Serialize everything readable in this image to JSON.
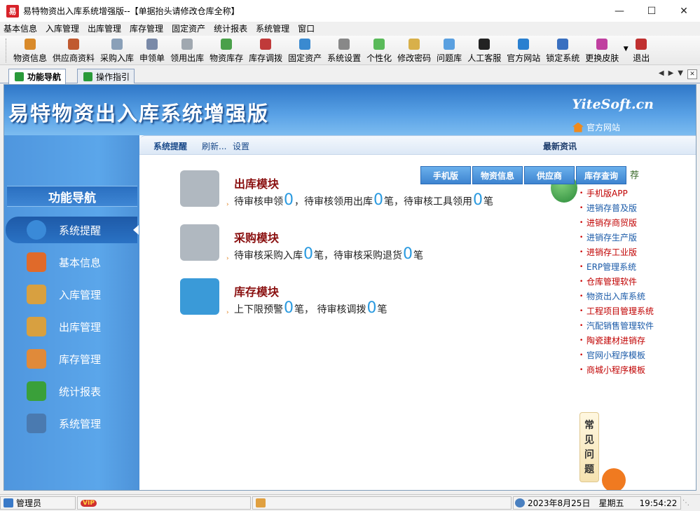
{
  "window": {
    "title": "易特物资出入库系统增强版--【单据抬头请修改仓库全称】",
    "app_icon_text": "易"
  },
  "menu": [
    "基本信息",
    "入库管理",
    "出库管理",
    "库存管理",
    "固定资产",
    "统计报表",
    "系统管理",
    "窗口"
  ],
  "toolbar": [
    {
      "label": "物资信息",
      "icon": "box-icon",
      "color": "#d98a2a"
    },
    {
      "label": "供应商资料",
      "icon": "people-icon",
      "color": "#c05a30"
    },
    {
      "label": "采购入库",
      "icon": "cart-in-icon",
      "color": "#8aa0b8"
    },
    {
      "label": "申领单",
      "icon": "calculator-icon",
      "color": "#7a8aa8"
    },
    {
      "label": "领用出库",
      "icon": "cart-out-icon",
      "color": "#a0a8b0"
    },
    {
      "label": "物资库存",
      "icon": "cubes-icon",
      "color": "#4aa04a"
    },
    {
      "label": "库存调拨",
      "icon": "transfer-icon",
      "color": "#c03a3a"
    },
    {
      "label": "固定资产",
      "icon": "stack-icon",
      "color": "#3a8ad0"
    },
    {
      "label": "系统设置",
      "icon": "settings-icon",
      "color": "#888888"
    },
    {
      "label": "个性化",
      "icon": "palette-icon",
      "color": "#5aba5a"
    },
    {
      "label": "修改密码",
      "icon": "pencil-icon",
      "color": "#d8b04a"
    },
    {
      "label": "问题库",
      "icon": "question-icon",
      "color": "#5aa0e0"
    },
    {
      "label": "人工客服",
      "icon": "qq-icon",
      "color": "#222222"
    },
    {
      "label": "官方网站",
      "icon": "ie-icon",
      "color": "#2a80d0"
    },
    {
      "label": "锁定系统",
      "icon": "lock-icon",
      "color": "#3a70c0"
    },
    {
      "label": "更换皮肤",
      "icon": "skin-icon",
      "color": "#c040a0"
    },
    {
      "label": "退出",
      "icon": "exit-icon",
      "color": "#c03030"
    }
  ],
  "tabs": [
    {
      "label": "功能导航",
      "active": true
    },
    {
      "label": "操作指引",
      "active": false
    }
  ],
  "banner": {
    "title": "易特物资出入库系统增强版",
    "site": "YiteSoft.cn",
    "home_link": "官方网站"
  },
  "sidebar": {
    "heading": "功能导航",
    "items": [
      {
        "label": "系统提醒",
        "icon": "info-icon",
        "color": "#3a8ad8",
        "active": true
      },
      {
        "label": "基本信息",
        "icon": "cubes-icon",
        "color": "#e06a2a",
        "active": false
      },
      {
        "label": "入库管理",
        "icon": "box-in-icon",
        "color": "#d8a040",
        "active": false
      },
      {
        "label": "出库管理",
        "icon": "box-out-icon",
        "color": "#d8a040",
        "active": false
      },
      {
        "label": "库存管理",
        "icon": "house-icon",
        "color": "#e08a3a",
        "active": false
      },
      {
        "label": "统计报表",
        "icon": "bar-chart-icon",
        "color": "#3aa03a",
        "active": false
      },
      {
        "label": "系统管理",
        "icon": "tools-icon",
        "color": "#4a7ab0",
        "active": false
      }
    ]
  },
  "content_head": {
    "reminder": "系统提醒",
    "refresh": "刷新...",
    "settings": "设置",
    "news_title": "最新资讯"
  },
  "modules": [
    {
      "title": "出库模块",
      "icon": "cart-remove-icon",
      "color": "#b0b8c0",
      "parts": [
        "待审核申领",
        "0",
        "，待审核领用出库",
        "0",
        "笔，待审核工具领用",
        "0",
        "笔"
      ]
    },
    {
      "title": "采购模块",
      "icon": "cart-add-icon",
      "color": "#b0b8c0",
      "parts": [
        "待审核采购入库",
        "0",
        "笔，待审核采购退货",
        "0",
        "笔"
      ]
    },
    {
      "title": "库存模块",
      "icon": "cubes-icon",
      "color": "#3a9ad8",
      "parts": [
        "上下限预警",
        "0",
        "笔，  待审核调拨",
        "0",
        "笔"
      ]
    }
  ],
  "news": {
    "tabs": [
      "手机版",
      "物资信息",
      "供应商",
      "库存查询"
    ],
    "tail_text": "荐",
    "items": [
      {
        "label": "手机版APP",
        "color": "#c00000"
      },
      {
        "label": "进销存普及版",
        "color": "#1a5aa8"
      },
      {
        "label": "进销存商贸版",
        "color": "#c00000"
      },
      {
        "label": "进销存生产版",
        "color": "#1a5aa8"
      },
      {
        "label": "进销存工业版",
        "color": "#c00000"
      },
      {
        "label": "ERP管理系统",
        "color": "#1a5aa8"
      },
      {
        "label": "仓库管理软件",
        "color": "#c00000"
      },
      {
        "label": "物资出入库系统",
        "color": "#1a5aa8"
      },
      {
        "label": "工程项目管理系统",
        "color": "#c00000"
      },
      {
        "label": "汽配销售管理软件",
        "color": "#1a5aa8"
      },
      {
        "label": "陶瓷建材进销存",
        "color": "#c00000"
      },
      {
        "label": "官网小程序模板",
        "color": "#1a5aa8"
      },
      {
        "label": "商城小程序模板",
        "color": "#c00000"
      }
    ]
  },
  "faq": [
    "常",
    "见",
    "问",
    "题"
  ],
  "status": {
    "user": "管理员",
    "vip": "VIP",
    "date": "2023年8月25日",
    "weekday": "星期五",
    "time": "19:54:22"
  }
}
